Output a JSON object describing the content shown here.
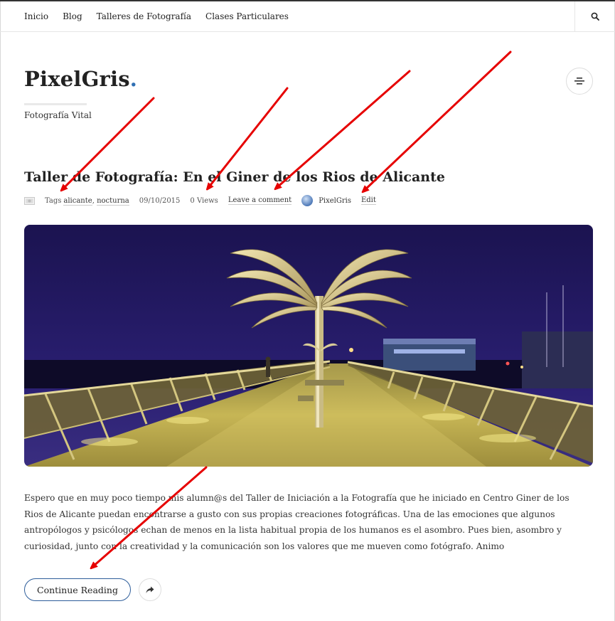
{
  "nav": {
    "items": [
      {
        "label": "Inicio"
      },
      {
        "label": "Blog"
      },
      {
        "label": "Talleres de Fotografía"
      },
      {
        "label": "Clases Particulares"
      }
    ]
  },
  "site": {
    "name": "PixelGris",
    "dot": ".",
    "tagline": "Fotografía Vital"
  },
  "post": {
    "title": "Taller de Fotografía: En el Giner de los Rios de Alicante",
    "tags_prefix": "Tags",
    "tags": [
      "alicante",
      "nocturna"
    ],
    "date": "09/10/2015",
    "views": "0 Views",
    "comment_link": "Leave a comment",
    "author": "PixelGris",
    "edit_link": "Edit",
    "excerpt": "Espero que en muy poco tiempo mis alumn@s del Taller de Iniciación a la Fotografía que he iniciado en Centro Giner de los Rios de Alicante puedan encontrarse a gusto con sus propias creaciones fotográficas. Una de las emociones que algunos antropólogos y psicólogos echan de menos en la lista habitual propia de los humanos es el asombro. Pues bien, asombro y curiosidad, junto con la creatividad y la comunicación son los valores que me mueven como fotógrafo. Animo",
    "continue_label": "Continue Reading"
  },
  "colors": {
    "accent": "#2f6fb3",
    "annotation_arrows": "#e60000"
  },
  "icons": {
    "search": "search-icon",
    "menu": "menu-icon",
    "format": "image-format-icon",
    "share": "share-icon"
  }
}
